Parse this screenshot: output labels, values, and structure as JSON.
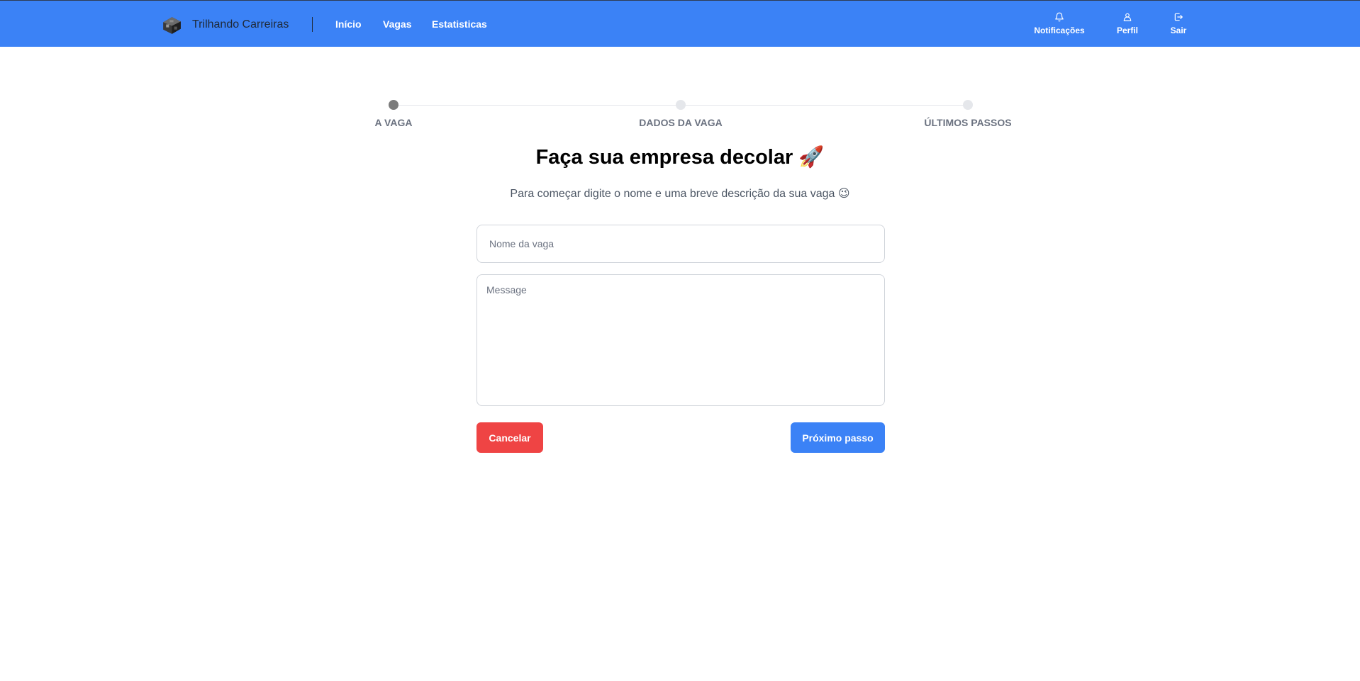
{
  "navbar": {
    "brand": "Trilhando Carreiras",
    "links": [
      "Início",
      "Vagas",
      "Estatisticas"
    ],
    "actions": [
      {
        "label": "Notificações",
        "icon": "bell-icon"
      },
      {
        "label": "Perfil",
        "icon": "user-icon"
      },
      {
        "label": "Sair",
        "icon": "logout-icon"
      }
    ],
    "background_color": "#3b82f6"
  },
  "stepper": {
    "steps": [
      {
        "label": "A VAGA",
        "active": true
      },
      {
        "label": "DADOS DA VAGA",
        "active": false
      },
      {
        "label": "ÚLTIMOS PASSOS",
        "active": false
      }
    ]
  },
  "form": {
    "heading": "Faça sua empresa decolar 🚀",
    "subtitle": "Para começar digite o nome e uma breve descrição da sua vaga 😉",
    "job_name_placeholder": "Nome da vaga",
    "job_name_value": "",
    "description_placeholder": "Message",
    "description_value": "",
    "cancel_label": "Cancelar",
    "cancel_color": "#ef4444",
    "next_label": "Próximo passo",
    "next_color": "#3b82f6"
  }
}
